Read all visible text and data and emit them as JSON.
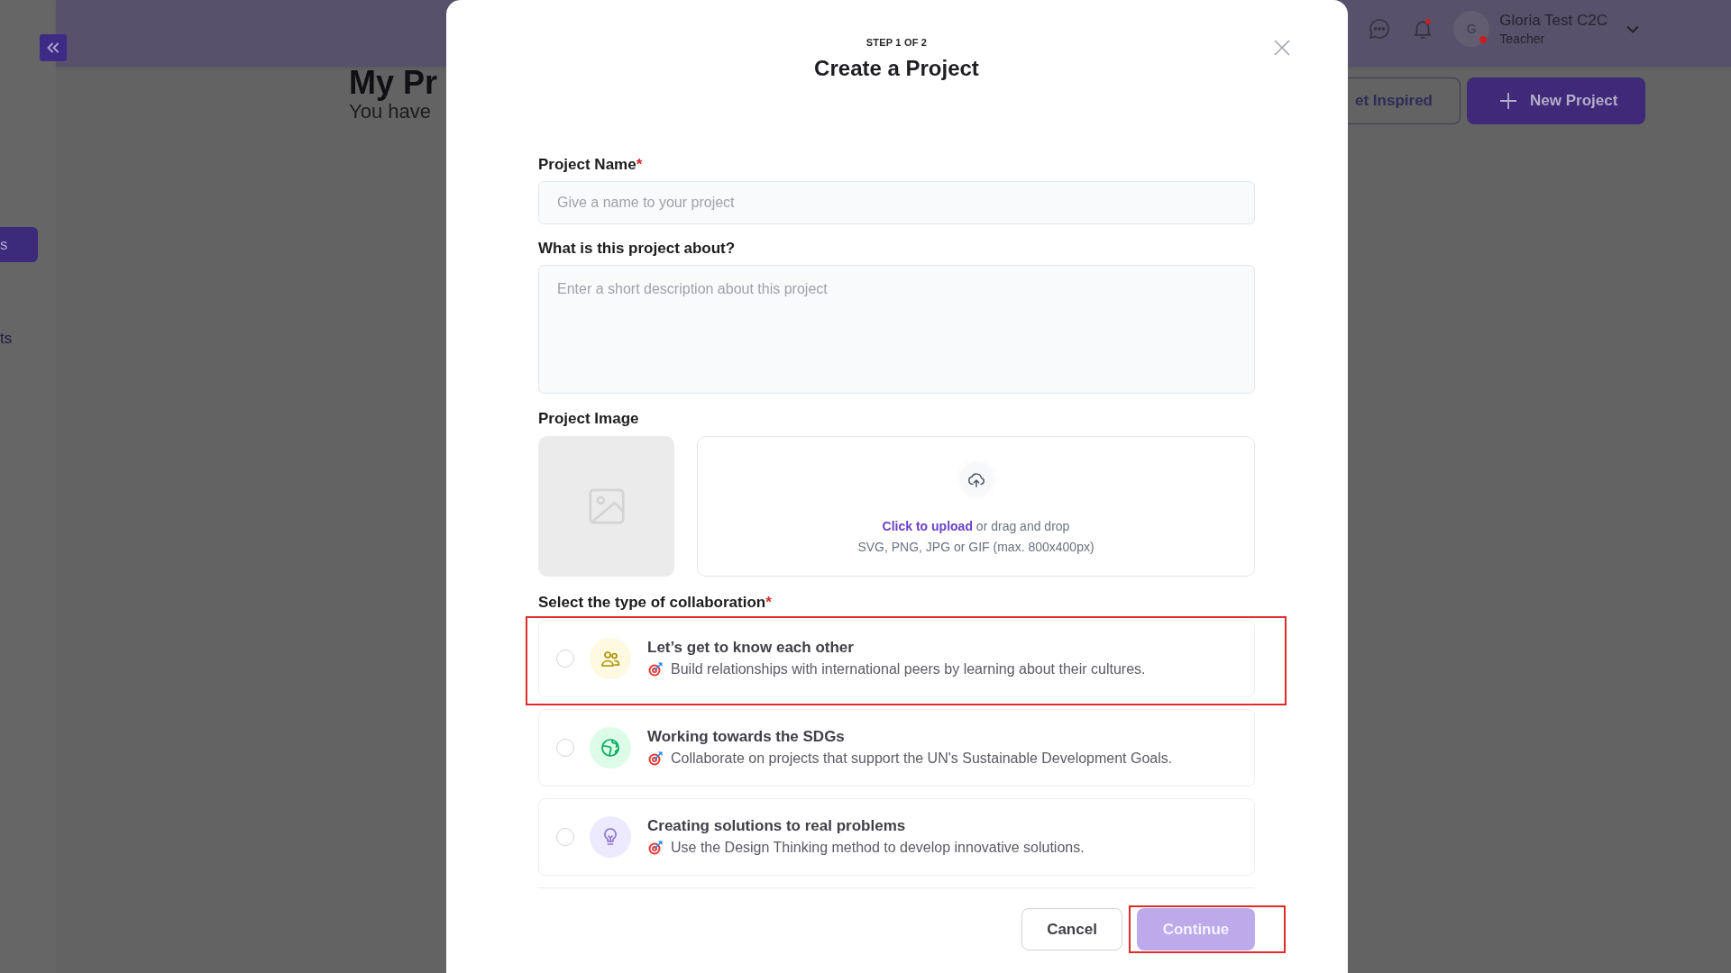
{
  "sidebar": {
    "items": [
      {
        "label": "s",
        "selected": true
      },
      {
        "label": "ts",
        "selected": false
      }
    ]
  },
  "header": {
    "bell": {
      "unread": true
    },
    "user": {
      "initial": "G",
      "name": "Gloria Test C2C",
      "role": "Teacher",
      "has_alert": true
    }
  },
  "page": {
    "title": "My Pr",
    "subtitle": "You have",
    "buttons": [
      {
        "kind": "outline",
        "label": "et Inspired"
      },
      {
        "kind": "primary",
        "label": "New Project"
      }
    ]
  },
  "modal": {
    "step": "STEP 1 OF 2",
    "title": "Create a Project",
    "fields": [
      {
        "kind": "input",
        "label": "Project Name",
        "required_mark": "*",
        "placeholder": "Give a name to your project"
      },
      {
        "kind": "textarea",
        "label": "What is this project about?",
        "placeholder": "Enter a short description about this project"
      }
    ],
    "image": {
      "label": "Project Image",
      "upload_link": "Click to upload",
      "upload_text": "or drag and drop",
      "formats": "SVG, PNG, JPG or GIF (max. 800x400px)"
    },
    "collaboration": {
      "label": "Select the type of collaboration",
      "required_mark": "*",
      "options": [
        {
          "title": "Let’s get to know each other",
          "description": "Build relationships with international peers by learning about their cultures.",
          "color": "#fef9e1",
          "selected": false,
          "highlighted": true
        },
        {
          "title": "Working towards the SDGs",
          "description": "Collaborate on projects that support the UN's Sustainable Development Goals.",
          "color": "#dcfce7",
          "selected": false,
          "highlighted": false
        },
        {
          "title": "Creating solutions to real problems",
          "description": "Use the Design Thinking method to develop innovative solutions.",
          "color": "#ede9fe",
          "selected": false,
          "highlighted": false
        }
      ]
    },
    "buttons": [
      {
        "kind": "secondary",
        "label": "Cancel",
        "disabled": false,
        "highlighted": false
      },
      {
        "kind": "primary",
        "label": "Continue",
        "disabled": true,
        "highlighted": true
      }
    ]
  }
}
